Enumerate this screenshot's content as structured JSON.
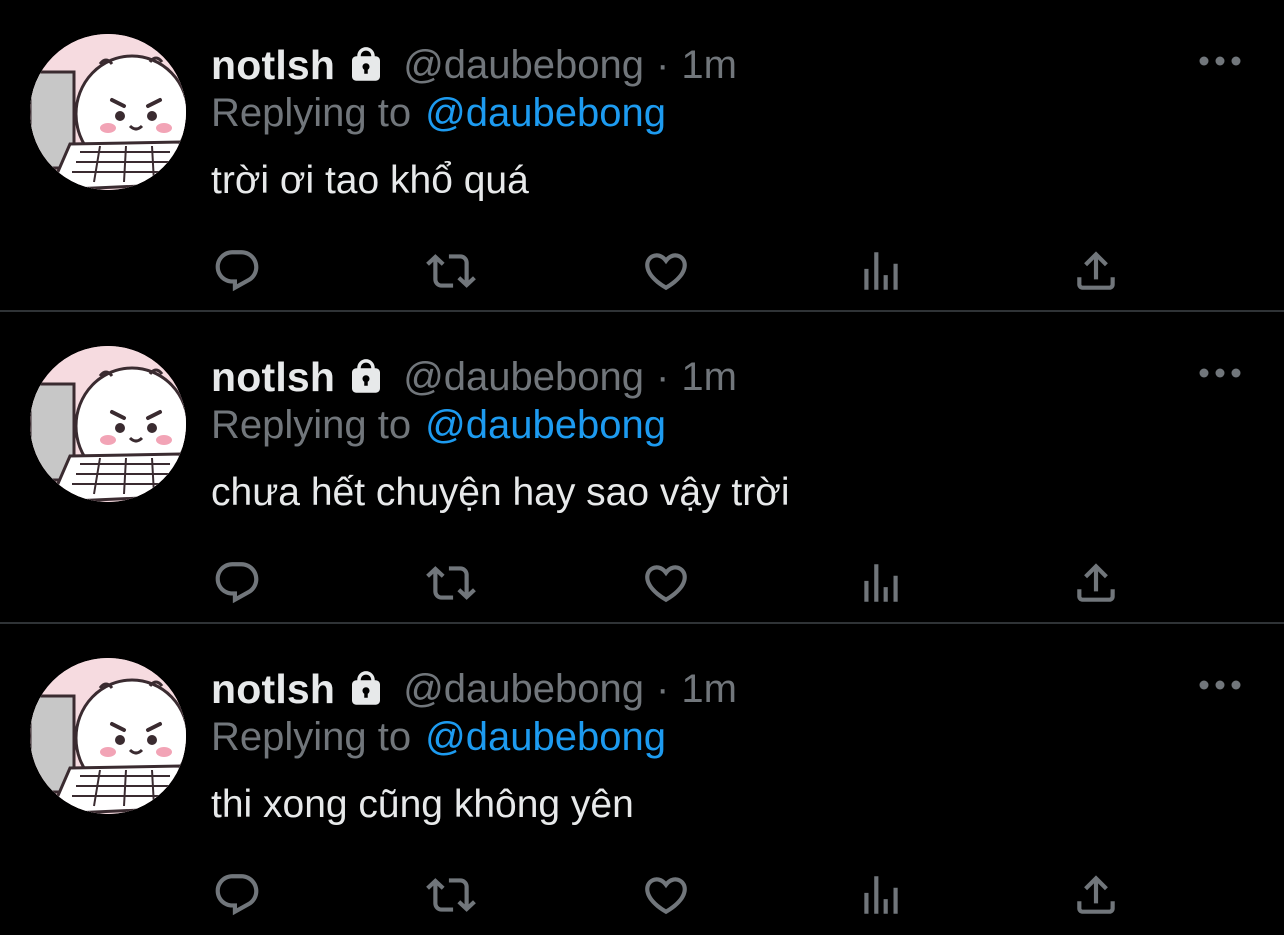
{
  "colors": {
    "background": "#000000",
    "primary_text": "#e7e9ea",
    "secondary_text": "#71767b",
    "accent": "#1d9bf0",
    "divider": "#2f3336"
  },
  "icons": {
    "lock": "lock-icon",
    "more": "more-dots-icon",
    "reply": "reply-bubble-icon",
    "retweet": "retweet-icon",
    "like": "heart-icon",
    "views": "views-bars-icon",
    "share": "share-upload-icon"
  },
  "tweets": [
    {
      "display_name": "notlsh",
      "handle": "@daubebong",
      "separator": "·",
      "time": "1m",
      "replying_label": "Replying to",
      "replying_to": "@daubebong",
      "text": "trời ơi tao khổ quá"
    },
    {
      "display_name": "notlsh",
      "handle": "@daubebong",
      "separator": "·",
      "time": "1m",
      "replying_label": "Replying to",
      "replying_to": "@daubebong",
      "text": "chưa hết chuyện hay sao vậy trời"
    },
    {
      "display_name": "notlsh",
      "handle": "@daubebong",
      "separator": "·",
      "time": "1m",
      "replying_label": "Replying to",
      "replying_to": "@daubebong",
      "text": "thi xong cũng không yên"
    }
  ]
}
